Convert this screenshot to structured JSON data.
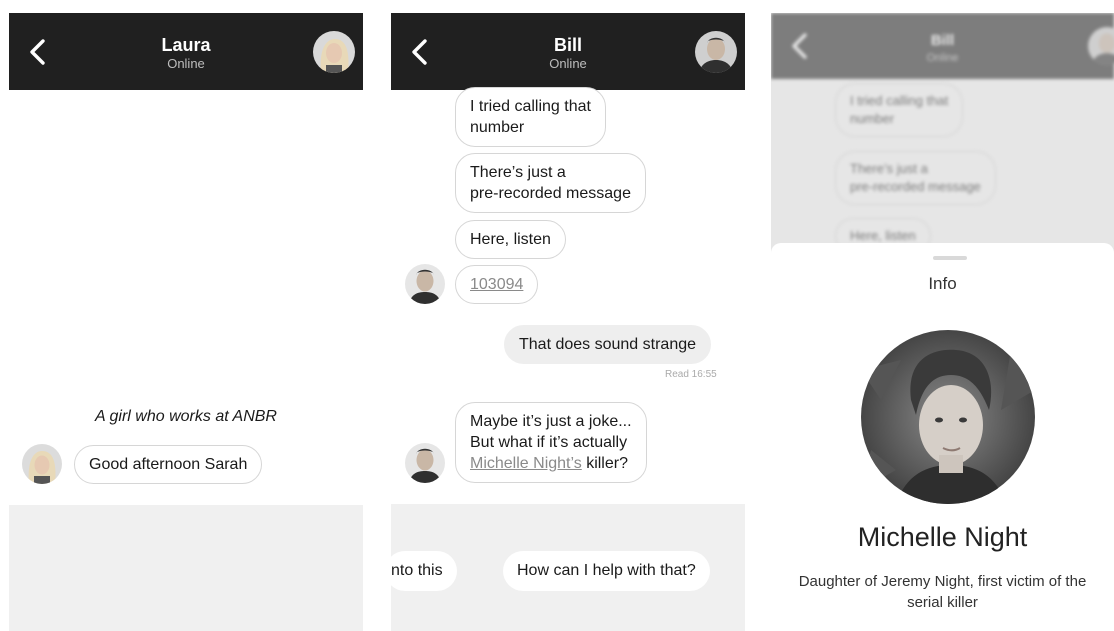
{
  "panels": [
    {
      "header": {
        "title": "Laura",
        "status": "Online",
        "back_icon": "chevron-left-icon"
      },
      "narration": "A girl who works at ANBR",
      "messages": [
        {
          "text": "Good afternoon Sarah",
          "direction": "incoming"
        }
      ]
    },
    {
      "header": {
        "title": "Bill",
        "status": "Online",
        "back_icon": "chevron-left-icon"
      },
      "messages": [
        {
          "text": "I tried calling that number",
          "line1": "I tried calling that",
          "line2": "number",
          "direction": "incoming"
        },
        {
          "text": "There’s just a pre-recorded message",
          "line1": "There’s just a",
          "line2": "pre-recorded message",
          "direction": "incoming"
        },
        {
          "text": "Here, listen",
          "direction": "incoming"
        },
        {
          "text": "103094",
          "direction": "incoming",
          "link": true
        },
        {
          "text": "That does sound strange",
          "direction": "outgoing",
          "receipt": "Read 16:55"
        },
        {
          "line1": "Maybe it’s just a joke...",
          "line2": "But what if it’s actually",
          "link_text": "Michelle Night’s",
          "after_link": " killer?",
          "direction": "incoming"
        }
      ],
      "replies": [
        "nto this",
        "How can I help with that?"
      ]
    },
    {
      "header": {
        "title": "Bill",
        "status": "Online"
      },
      "background_messages": [
        {
          "line1": "I tried calling that",
          "line2": "number"
        },
        {
          "line1": "There’s just a",
          "line2": "pre-recorded message"
        },
        {
          "line1": "Here, listen"
        }
      ],
      "info_sheet": {
        "title": "Info",
        "name": "Michelle Night",
        "description": "Daughter of Jeremy Night, first victim of the serial killer"
      }
    }
  ],
  "colors": {
    "header_bg": "#202020",
    "tray_bg": "#f0f0f0",
    "outgoing_bubble": "#eeeeee",
    "bubble_border": "#d6d6d6"
  }
}
